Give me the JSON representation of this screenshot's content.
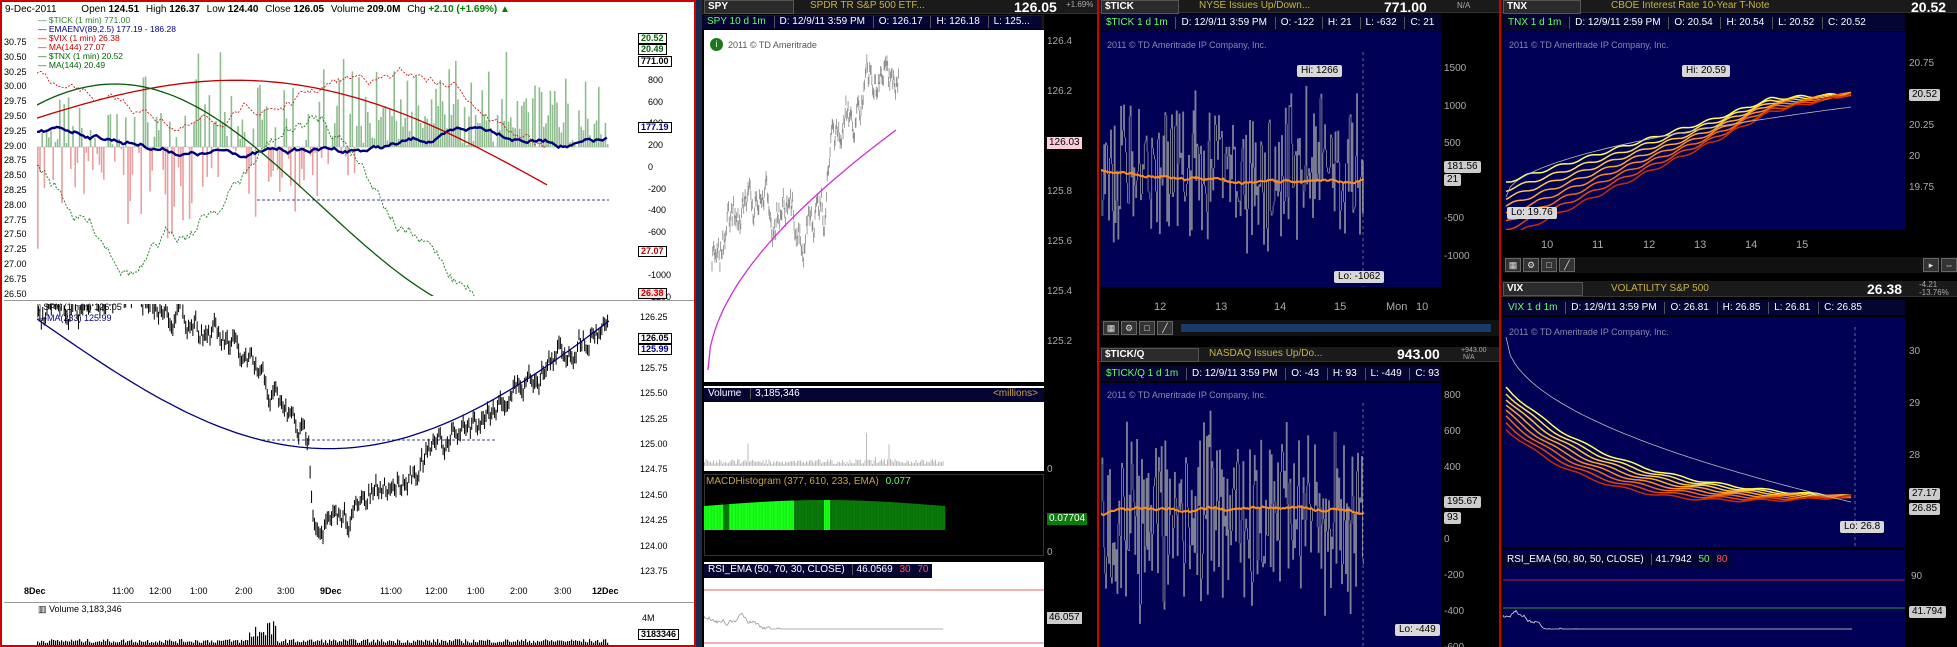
{
  "left_chart": {
    "date": "9-Dec-2011",
    "open_label": "Open",
    "open": "124.51",
    "high_label": "High",
    "high": "126.37",
    "low_label": "Low",
    "low": "124.40",
    "close_label": "Close",
    "close": "126.05",
    "volume_label": "Volume",
    "volume": "209.0M",
    "chg_label": "Chg",
    "chg": "+2.10 (+1.69%)",
    "chg_arrow": "▲",
    "legend": [
      {
        "text": "$TICK (1 min) 771.00",
        "color": "#2e7d32"
      },
      {
        "text": "EMAENV(89,2.5) 177.19 - 186.28",
        "color": "#00007a"
      },
      {
        "text": "$VIX (1 min) 26.38",
        "color": "#c00000"
      },
      {
        "text": "MA(144) 27.07",
        "color": "#c00000"
      },
      {
        "text": "$TNX (1 min) 20.52",
        "color": "#006400"
      },
      {
        "text": "MA(144) 20.49",
        "color": "#006400"
      }
    ],
    "upper_left_axis": [
      "30.75",
      "30.50",
      "30.25",
      "30.00",
      "29.75",
      "29.50",
      "29.25",
      "29.00",
      "28.75",
      "28.50",
      "28.25",
      "28.00",
      "27.75",
      "27.50",
      "27.25",
      "27.00",
      "26.75",
      "26.50"
    ],
    "upper_right_axis": [
      "800",
      "600",
      "400",
      "200",
      "0",
      "-200",
      "-400",
      "-600",
      "-800",
      "-1000",
      "-1200"
    ],
    "upper_tags": {
      "tnx": "20.52",
      "tnx2": "20.49",
      "tick": "771.00",
      "ema": "177.19",
      "ma": "27.07",
      "vix": "26.38"
    },
    "spy_legend_1": "SPY (1 min) 126.05",
    "spy_legend_2": "MA(233) 125.99",
    "spy_axis": [
      "126.25",
      "126.00",
      "125.75",
      "125.50",
      "125.25",
      "125.00",
      "124.75",
      "124.50",
      "124.25",
      "124.00",
      "123.75"
    ],
    "spy_tags": {
      "price": "126.05",
      "ma": "125.99"
    },
    "x_labels": [
      "8Dec",
      "11:00",
      "12:00",
      "1:00",
      "2:00",
      "3:00",
      "9Dec",
      "11:00",
      "12:00",
      "1:00",
      "2:00",
      "3:00",
      "12Dec"
    ],
    "volume_legend": "Volume 3,183,346",
    "volume_axis": "4M",
    "volume_tag": "3183346"
  },
  "spy_panel": {
    "symbol": "SPY",
    "description": "SPDR TR S&P 500 ETF...",
    "price": "126.05",
    "change": "+1.69%",
    "info_title": "SPY 10 d 1m",
    "info": [
      "D: 12/9/11 3:59 PM",
      "O: 126.17",
      "H: 126.18",
      "L: 125..."
    ],
    "copyright": "2011 © TD Ameritrade",
    "price_axis": [
      "126.4",
      "126.2",
      "126",
      "125.8",
      "125.6",
      "125.4",
      "125.2"
    ],
    "price_tag": "126.03",
    "volume_label": "Volume",
    "volume_value": "3,185,346",
    "volume_units": "<millions>",
    "vol_axis": "0",
    "macd_label": "MACDHistogram (377, 610, 233, EMA)",
    "macd_value": "0.077",
    "macd_axis": "0",
    "macd_tag": "0.07704",
    "rsi_label": "RSI_EMA (50, 70, 30, CLOSE)",
    "rsi_value": "46.0569",
    "rsi_ob": "30",
    "rsi_os": "70",
    "rsi_tag": "46.057"
  },
  "tick_panel": {
    "symbol": "$TICK",
    "description": "NYSE Issues Up/Down...",
    "price": "771.00",
    "na": "N/A",
    "info_title": "$TICK 1 d 1m",
    "info": [
      "D: 12/9/11 3:59 PM",
      "O: -122",
      "H: 21",
      "L: -632",
      "C: 21"
    ],
    "copyright": "2011 © TD Ameritrade IP Company, Inc.",
    "axis": [
      "1500",
      "1000",
      "500",
      "0",
      "-500",
      "-1000"
    ],
    "hi_label": "Hi: 1266",
    "lo_label": "Lo: -1062",
    "tags": [
      "181.56",
      "21"
    ],
    "x_labels": [
      "12",
      "13",
      "14",
      "15",
      "Mon",
      "10"
    ]
  },
  "ticko_panel": {
    "symbol": "$TICK/Q",
    "description": "NASDAQ Issues Up/Do...",
    "price": "943.00",
    "change": "+943.00",
    "na": "N/A",
    "info_title": "$TICK/Q 1 d 1m",
    "info": [
      "D: 12/9/11 3:59 PM",
      "O: -43",
      "H: 93",
      "L: -449",
      "C: 93"
    ],
    "copyright": "2011 © TD Ameritrade IP Company, Inc.",
    "axis": [
      "800",
      "600",
      "400",
      "200",
      "0",
      "-200",
      "-400",
      "-600"
    ],
    "lo_label": "Lo: -449",
    "tags": [
      "195.67",
      "93"
    ]
  },
  "tnx_panel": {
    "symbol": "TNX",
    "description": "CBOE Interest Rate 10-Year T-Note",
    "price": "20.52",
    "info_title": "TNX 1 d 1m",
    "info": [
      "D: 12/9/11 2:59 PM",
      "O: 20.54",
      "H: 20.54",
      "L: 20.52",
      "C: 20.52"
    ],
    "copyright": "2011 © TD Ameritrade IP Company, Inc.",
    "axis": [
      "20.75",
      "20.5",
      "20.25",
      "20",
      "19.75"
    ],
    "hi_label": "Hi: 20.59",
    "lo_label": "Lo: 19.76",
    "tag": "20.52",
    "x_labels": [
      "10",
      "11",
      "12",
      "13",
      "14",
      "15"
    ]
  },
  "vix_panel": {
    "symbol": "VIX",
    "description": "VOLATILITY S&P 500",
    "price": "26.38",
    "change": "-4.21",
    "change_pct": "-13.76%",
    "info_title": "VIX 1 d 1m",
    "info": [
      "D: 12/9/11 3:59 PM",
      "O: 26.81",
      "H: 26.85",
      "L: 26.81",
      "C: 26.85"
    ],
    "copyright": "2011 © TD Ameritrade IP Company, Inc.",
    "axis": [
      "30",
      "29",
      "28",
      "27"
    ],
    "lo_label": "Lo: 26.8",
    "tags": [
      "27.17",
      "26.85"
    ],
    "rsi_label": "RSI_EMA (50, 80, 50, CLOSE)",
    "rsi_value": "41.7942",
    "rsi_mid": "50",
    "rsi_hi": "80",
    "rsi_axis": "90",
    "rsi_tag": "41.794"
  }
}
